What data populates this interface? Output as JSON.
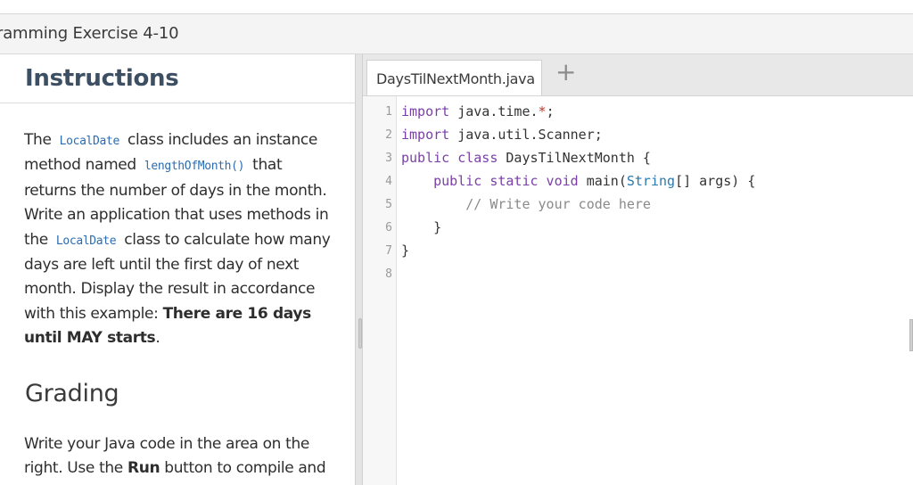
{
  "header": {
    "title": "ramming Exercise 4-10"
  },
  "instructions": {
    "heading": "Instructions",
    "p1": "The",
    "code1": "LocalDate",
    "p2": "class includes an instance method named",
    "code2": "lengthOfMonth()",
    "p3": "that returns the number of days in the month. Write an application that uses methods in the",
    "code3": "LocalDate",
    "p4": "class to calculate how many days are left until the first day of next month. Display the result in accordance with this example:",
    "bold_example": "There are 16 days until MAY starts",
    "p5": "."
  },
  "grading": {
    "heading": "Grading",
    "p1": "Write your Java code in the area on the right. Use the",
    "run_label": "Run",
    "p2": "button to compile and"
  },
  "editor": {
    "tab_label": "DaysTilNextMonth.java",
    "add_tab_icon": "+",
    "line_numbers": [
      "1",
      "2",
      "3",
      "4",
      "5",
      "6",
      "7",
      "8"
    ]
  }
}
